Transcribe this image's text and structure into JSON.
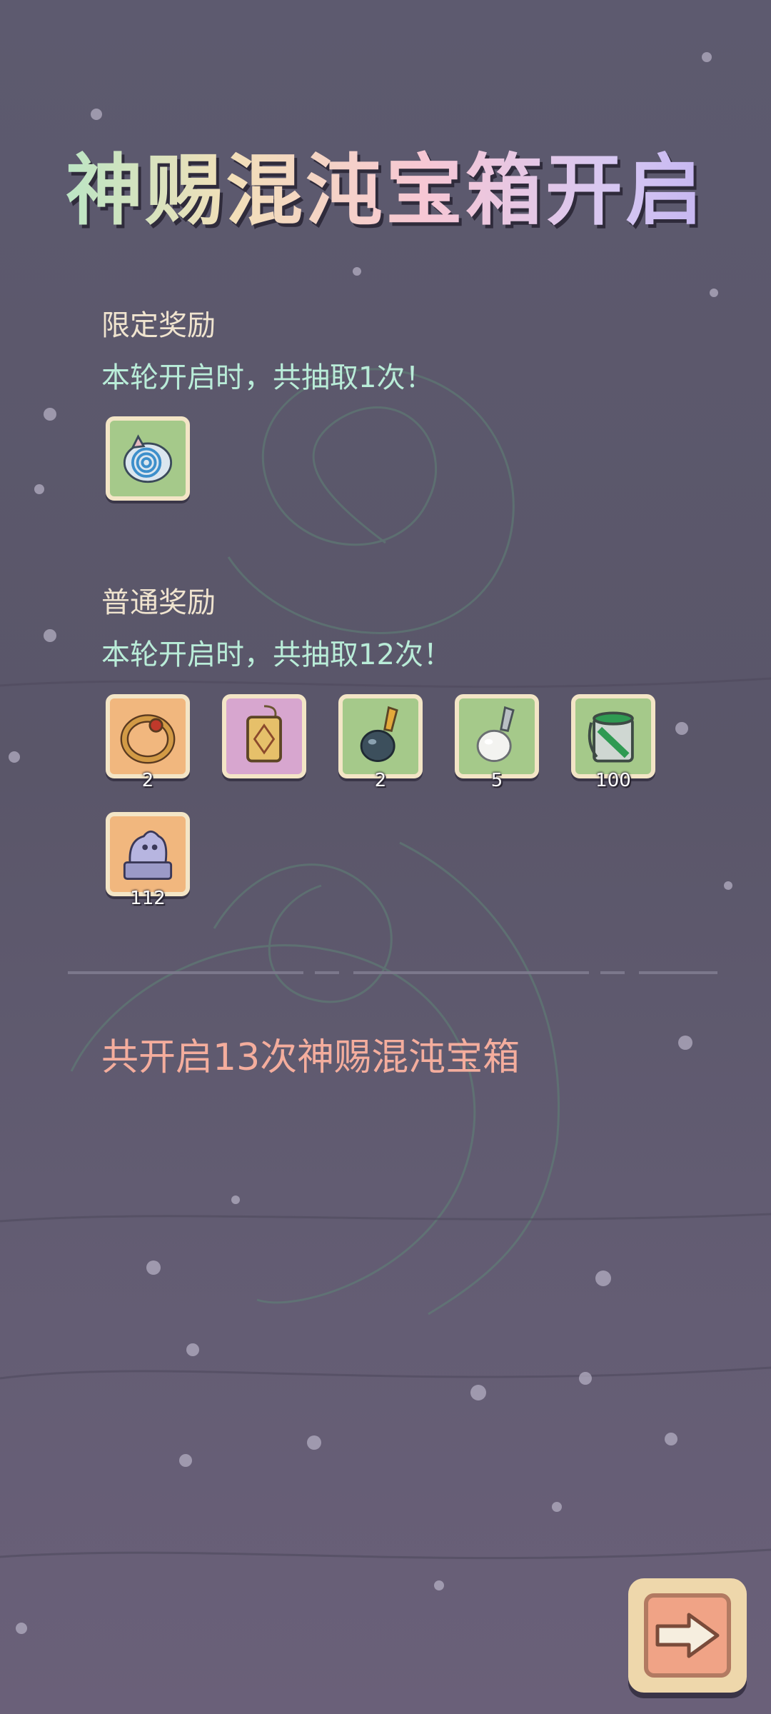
{
  "title": "神赐混沌宝箱开启",
  "limited": {
    "heading": "限定奖励",
    "subtitle": "本轮开启时，共抽取1次！",
    "items": [
      {
        "name": "spiral-mask",
        "bg": "green",
        "count": ""
      }
    ]
  },
  "normal": {
    "heading": "普通奖励",
    "subtitle": "本轮开启时，共抽取12次！",
    "items": [
      {
        "name": "ring",
        "bg": "orange",
        "count": "2"
      },
      {
        "name": "amulet",
        "bg": "purple",
        "count": ""
      },
      {
        "name": "dark-pendant",
        "bg": "green",
        "count": "2"
      },
      {
        "name": "pearl-pendant",
        "bg": "green",
        "count": "5"
      },
      {
        "name": "paint-bucket",
        "bg": "green",
        "count": "100"
      },
      {
        "name": "lion-statue",
        "bg": "orange",
        "count": "112"
      }
    ]
  },
  "summary": "共开启13次神赐混沌宝箱",
  "colors": {
    "background": "#5d5a6f",
    "green_tile": "#a5c98a",
    "orange_tile": "#f1b77e",
    "purple_tile": "#d7a6cf",
    "summary_text": "#f4ad9d",
    "subtitle_text": "#b9ecd8"
  },
  "next_button_icon": "arrow-right-icon"
}
